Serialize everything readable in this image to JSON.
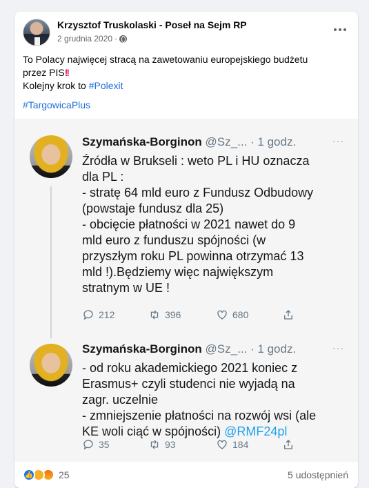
{
  "post": {
    "author": "Krzysztof Truskolaski - Poseł na Sejm RP",
    "date": "2 grudnia 2020",
    "text_line1": "To Polacy najwięcej stracą na zawetowaniu europejskiego budżetu",
    "text_line2_prefix": "przez PIS",
    "text_line2_emoji": "!!",
    "text_line3_prefix": "Kolejny krok to ",
    "text_line3_hashtag": "#Polexit",
    "hashtag2": "#TargowicaPlus"
  },
  "tweets": [
    {
      "name": "Szymańska-Borginon",
      "handle": "@Sz_...",
      "time": "· 1 godz.",
      "more": "···",
      "lines": [
        "Źródła w Brukseli : weto PL i HU oznacza",
        "dla PL :",
        "- stratę 64 mld euro z Fundusz Odbudowy",
        "(powstaje fundusz dla 25)",
        " - obcięcie płatności w 2021 nawet do 9",
        "mld euro z funduszu spójności (w",
        "przyszłym roku PL powinna otrzymać 13",
        "mld !).Będziemy więc największym",
        "stratnym w UE !"
      ],
      "replies": "212",
      "retweets": "396",
      "likes": "680"
    },
    {
      "name": "Szymańska-Borginon",
      "handle": "@Sz_...",
      "time": "· 1 godz.",
      "more": "···",
      "lines": [
        "- od roku akademickiego 2021 koniec z",
        "Erasmus+ czyli studenci nie wyjadą na",
        "zagr. uczelnie",
        "- zmniejszenie płatności na rozwój wsi (ale",
        "KE woli ciąć w spójności) "
      ],
      "mention": "@RMF24pl",
      "replies": "35",
      "retweets": "93",
      "likes": "184"
    }
  ],
  "footer": {
    "reaction_count": "25",
    "shares": "5 udostępnień"
  },
  "colors": {
    "link": "#216fdb",
    "twitter_link": "#1da1f2",
    "like": "#1877f2"
  },
  "icons": [
    "globe-icon",
    "more-icon",
    "reply-icon",
    "retweet-icon",
    "heart-icon",
    "share-icon",
    "like-reaction-icon",
    "sad-reaction-icon",
    "angry-reaction-icon"
  ]
}
